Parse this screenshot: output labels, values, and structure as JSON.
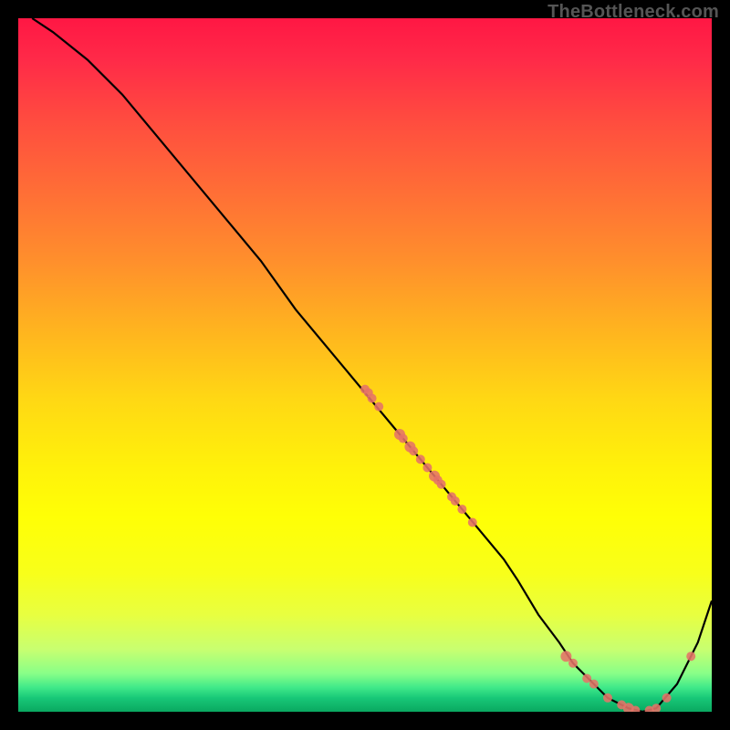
{
  "watermark": "TheBottleneck.com",
  "chart_data": {
    "type": "line",
    "title": "",
    "xlabel": "",
    "ylabel": "",
    "xlim": [
      0,
      100
    ],
    "ylim": [
      0,
      100
    ],
    "curve": {
      "x": [
        2,
        5,
        10,
        15,
        20,
        25,
        30,
        35,
        40,
        45,
        50,
        55,
        60,
        65,
        70,
        72,
        75,
        78,
        80,
        83,
        85,
        88,
        90,
        92,
        95,
        98,
        100
      ],
      "y": [
        100,
        98,
        94,
        89,
        83,
        77,
        71,
        65,
        58,
        52,
        46,
        40,
        34,
        28,
        22,
        19,
        14,
        10,
        7,
        4,
        2,
        0.5,
        0,
        0.5,
        4,
        10,
        16
      ]
    },
    "scatter": [
      {
        "x": 50,
        "y": 46.5,
        "r": 5
      },
      {
        "x": 50.5,
        "y": 46,
        "r": 5
      },
      {
        "x": 51,
        "y": 45.2,
        "r": 5
      },
      {
        "x": 52,
        "y": 44,
        "r": 5
      },
      {
        "x": 55,
        "y": 40,
        "r": 6
      },
      {
        "x": 55.5,
        "y": 39.4,
        "r": 5
      },
      {
        "x": 56.5,
        "y": 38.2,
        "r": 6
      },
      {
        "x": 57,
        "y": 37.6,
        "r": 5
      },
      {
        "x": 58,
        "y": 36.4,
        "r": 5
      },
      {
        "x": 59,
        "y": 35.2,
        "r": 5
      },
      {
        "x": 60,
        "y": 34,
        "r": 6
      },
      {
        "x": 60.5,
        "y": 33.4,
        "r": 5
      },
      {
        "x": 61,
        "y": 32.8,
        "r": 5
      },
      {
        "x": 62.5,
        "y": 31,
        "r": 5
      },
      {
        "x": 63,
        "y": 30.4,
        "r": 5
      },
      {
        "x": 64,
        "y": 29.2,
        "r": 5
      },
      {
        "x": 65.5,
        "y": 27.3,
        "r": 5
      },
      {
        "x": 79,
        "y": 8,
        "r": 6
      },
      {
        "x": 80,
        "y": 7,
        "r": 5
      },
      {
        "x": 82,
        "y": 4.8,
        "r": 5
      },
      {
        "x": 83,
        "y": 4,
        "r": 5
      },
      {
        "x": 85,
        "y": 2,
        "r": 5
      },
      {
        "x": 87,
        "y": 1,
        "r": 5
      },
      {
        "x": 88,
        "y": 0.5,
        "r": 6
      },
      {
        "x": 89,
        "y": 0.2,
        "r": 5
      },
      {
        "x": 91,
        "y": 0.2,
        "r": 5
      },
      {
        "x": 92,
        "y": 0.5,
        "r": 5
      },
      {
        "x": 93.5,
        "y": 2,
        "r": 5
      },
      {
        "x": 97,
        "y": 8,
        "r": 5
      }
    ],
    "gradient_stops": [
      {
        "offset": 0.0,
        "color": "#ff1744"
      },
      {
        "offset": 0.06,
        "color": "#ff2a48"
      },
      {
        "offset": 0.15,
        "color": "#ff4d3f"
      },
      {
        "offset": 0.25,
        "color": "#ff6e36"
      },
      {
        "offset": 0.35,
        "color": "#ff8f2c"
      },
      {
        "offset": 0.45,
        "color": "#ffb41f"
      },
      {
        "offset": 0.55,
        "color": "#ffd814"
      },
      {
        "offset": 0.65,
        "color": "#fff20a"
      },
      {
        "offset": 0.72,
        "color": "#ffff06"
      },
      {
        "offset": 0.8,
        "color": "#f8ff1a"
      },
      {
        "offset": 0.86,
        "color": "#e8ff40"
      },
      {
        "offset": 0.91,
        "color": "#c8ff70"
      },
      {
        "offset": 0.945,
        "color": "#88ff88"
      },
      {
        "offset": 0.965,
        "color": "#40e989"
      },
      {
        "offset": 0.98,
        "color": "#18c878"
      },
      {
        "offset": 1.0,
        "color": "#0aa860"
      }
    ],
    "annotations": []
  }
}
